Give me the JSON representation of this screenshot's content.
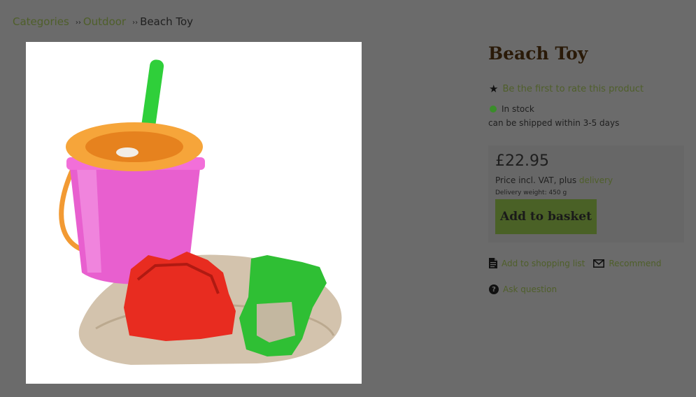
{
  "breadcrumb": {
    "items": [
      {
        "label": "Categories"
      },
      {
        "label": "Outdoor"
      }
    ],
    "separator": "››",
    "current": "Beach Toy"
  },
  "product": {
    "title": "Beach Toy",
    "rating_text": "Be the first to rate this product",
    "stock": "In stock",
    "shipping": "can be shipped within 3-5 days",
    "price": "£22.95",
    "vat_prefix": "Price incl. VAT, plus ",
    "vat_link": "delivery",
    "delivery_weight": "Delivery weight: 450 g",
    "add_to_basket": "Add to basket"
  },
  "actions": {
    "shopping_list": "Add to shopping list",
    "recommend": "Recommend",
    "ask_question": "Ask question"
  },
  "icons": {
    "rating": "star-icon",
    "stock": "status-dot-icon",
    "shopping_list": "document-icon",
    "recommend": "envelope-icon",
    "ask_question": "question-icon"
  },
  "colors": {
    "background": "#6b6b6b",
    "link": "#4f5f2a",
    "button": "#4a6126",
    "in_stock": "#3a8d2a",
    "title": "#2a1a08"
  }
}
